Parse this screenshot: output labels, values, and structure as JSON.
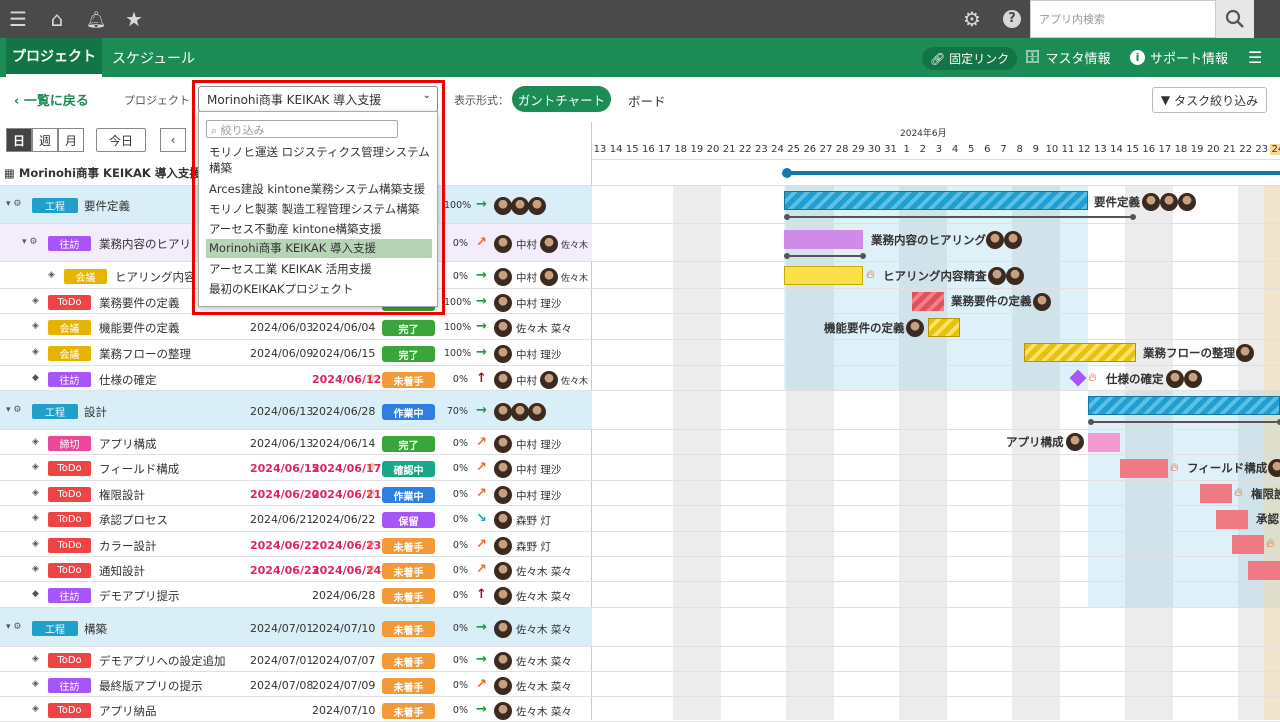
{
  "topbar": {
    "search_placeholder": "アプリ内検索"
  },
  "nav": {
    "tabs": [
      "プロジェクト",
      "スケジュール"
    ],
    "fixed_link": "固定リンク",
    "master": "マスタ情報",
    "support": "サポート情報"
  },
  "toolbar": {
    "back": "一覧に戻る",
    "project_label": "プロジェクト：",
    "project_value": "Morinohi商事 KEIKAK 導入支援",
    "view_label": "表示形式：",
    "gantt": "ガントチャート",
    "board": "ボード",
    "task_filter": "タスク絞り込み"
  },
  "controls": {
    "day": "日",
    "week": "週",
    "month": "月",
    "today": "今日"
  },
  "dropdown": {
    "placeholder": "絞り込み",
    "options": [
      "モリノヒ運送 ロジスティクス管理システム構築",
      "Arces建設 kintone業務システム構築支援",
      "モリノヒ製薬 製造工程管理システム構築",
      "アーセス不動産 kintone構築支援",
      "Morinohi商事 KEIKAK 導入支援",
      "アーセス工業 KEIKAK 活用支援",
      "最初のKEIKAKプロジェクト"
    ],
    "selected_index": 4
  },
  "gantt": {
    "month": "2024年6月",
    "days": [
      "13",
      "14",
      "15",
      "16",
      "17",
      "18",
      "19",
      "20",
      "21",
      "22",
      "23",
      "24",
      "25",
      "26",
      "27",
      "28",
      "29",
      "30",
      "31",
      "1",
      "2",
      "3",
      "4",
      "5",
      "6",
      "7",
      "8",
      "9",
      "10",
      "11",
      "12",
      "13",
      "14",
      "15",
      "16",
      "17",
      "18",
      "19",
      "20",
      "21",
      "22",
      "23",
      "24"
    ],
    "labels": [
      "要件定義",
      "業務内容のヒアリング",
      "ヒアリング内容精査",
      "業務要件の定義",
      "機能要件の定義",
      "業務フローの整理",
      "仕様の確定",
      "アプリ構成",
      "フィールド構成",
      "権限設",
      "承認フ"
    ]
  },
  "project_title": "Morinohi商事 KEIKAK 導入支援",
  "rows": [
    {
      "type": "phase",
      "badge": "工程",
      "name": "要件定義",
      "start": "",
      "end": "",
      "status": "",
      "pct": "100%",
      "arrow": "→"
    },
    {
      "type": "task",
      "badge": "往訪",
      "name": "業務内容のヒアリング",
      "start": "",
      "end": "",
      "status": "",
      "pct": "0%",
      "arrow": "↗",
      "who": [
        "中村",
        "佐々木"
      ]
    },
    {
      "type": "task",
      "badge": "会議",
      "name": "ヒアリング内容精査",
      "start": "",
      "end": "",
      "status": "",
      "pct": "0%",
      "arrow": "→",
      "who": [
        "中村",
        "佐々木"
      ]
    },
    {
      "type": "task",
      "badge": "ToDo",
      "name": "業務要件の定義",
      "start": "",
      "end": "",
      "status": "",
      "pct": "100%",
      "arrow": "→",
      "who": [
        "中村 理沙"
      ]
    },
    {
      "type": "task",
      "badge": "会議",
      "name": "機能要件の定義",
      "start": "2024/06/03",
      "end": "2024/06/04",
      "status": "完了",
      "pct": "100%",
      "arrow": "→",
      "who": [
        "佐々木 菜々"
      ]
    },
    {
      "type": "task",
      "badge": "会議",
      "name": "業務フローの整理",
      "start": "2024/06/09",
      "end": "2024/06/15",
      "status": "完了",
      "pct": "100%",
      "arrow": "→",
      "who": [
        "中村 理沙"
      ]
    },
    {
      "type": "task",
      "badge": "往訪",
      "name": "仕様の確定",
      "start": "",
      "end": "2024/06/12",
      "status": "未着手",
      "pct": "0%",
      "arrow": "↑",
      "who": [
        "中村",
        "佐々木"
      ]
    },
    {
      "type": "phase",
      "badge": "工程",
      "name": "設計",
      "start": "2024/06/13",
      "end": "2024/06/28",
      "status": "作業中",
      "pct": "70%",
      "arrow": "→"
    },
    {
      "type": "task",
      "badge": "締切",
      "name": "アプリ構成",
      "start": "2024/06/13",
      "end": "2024/06/14",
      "status": "完了",
      "pct": "0%",
      "arrow": "↗",
      "who": [
        "中村 理沙"
      ]
    },
    {
      "type": "task",
      "badge": "ToDo",
      "name": "フィールド構成",
      "start": "2024/06/15",
      "end": "2024/06/17",
      "status": "確認中",
      "pct": "0%",
      "arrow": "↗",
      "who": [
        "中村 理沙"
      ]
    },
    {
      "type": "task",
      "badge": "ToDo",
      "name": "権限設計",
      "start": "2024/06/20",
      "end": "2024/06/21",
      "status": "作業中",
      "pct": "0%",
      "arrow": "↗",
      "who": [
        "中村 理沙"
      ]
    },
    {
      "type": "task",
      "badge": "ToDo",
      "name": "承認プロセス",
      "start": "2024/06/21",
      "end": "2024/06/22",
      "status": "保留",
      "pct": "0%",
      "arrow": "↘",
      "who": [
        "森野 灯"
      ]
    },
    {
      "type": "task",
      "badge": "ToDo",
      "name": "カラー設計",
      "start": "2024/06/22",
      "end": "2024/06/23",
      "status": "未着手",
      "pct": "0%",
      "arrow": "↗",
      "who": [
        "森野 灯"
      ]
    },
    {
      "type": "task",
      "badge": "ToDo",
      "name": "通知設計",
      "start": "2024/06/23",
      "end": "2024/06/24",
      "status": "未着手",
      "pct": "0%",
      "arrow": "↗",
      "who": [
        "佐々木 菜々"
      ]
    },
    {
      "type": "task",
      "badge": "往訪",
      "name": "デモアプリ提示",
      "start": "",
      "end": "2024/06/28",
      "status": "未着手",
      "pct": "0%",
      "arrow": "↑",
      "who": [
        "佐々木 菜々"
      ]
    },
    {
      "type": "phase",
      "badge": "工程",
      "name": "構築",
      "start": "2024/07/01",
      "end": "2024/07/10",
      "status": "未着手",
      "pct": "0%",
      "arrow": "→",
      "who": [
        "佐々木 菜々"
      ]
    },
    {
      "type": "task",
      "badge": "ToDo",
      "name": "デモアプリへの設定追加",
      "start": "2024/07/01",
      "end": "2024/07/07",
      "status": "未着手",
      "pct": "0%",
      "arrow": "→",
      "who": [
        "佐々木 菜々"
      ]
    },
    {
      "type": "task",
      "badge": "往訪",
      "name": "最終版アプリの提示",
      "start": "2024/07/08",
      "end": "2024/07/09",
      "status": "未着手",
      "pct": "0%",
      "arrow": "↗",
      "who": [
        "佐々木 菜々"
      ]
    },
    {
      "type": "task",
      "badge": "ToDo",
      "name": "アプリ納品",
      "start": "",
      "end": "2024/07/10",
      "status": "未着手",
      "pct": "0%",
      "arrow": "→",
      "who": [
        "佐々木 菜々"
      ]
    }
  ]
}
